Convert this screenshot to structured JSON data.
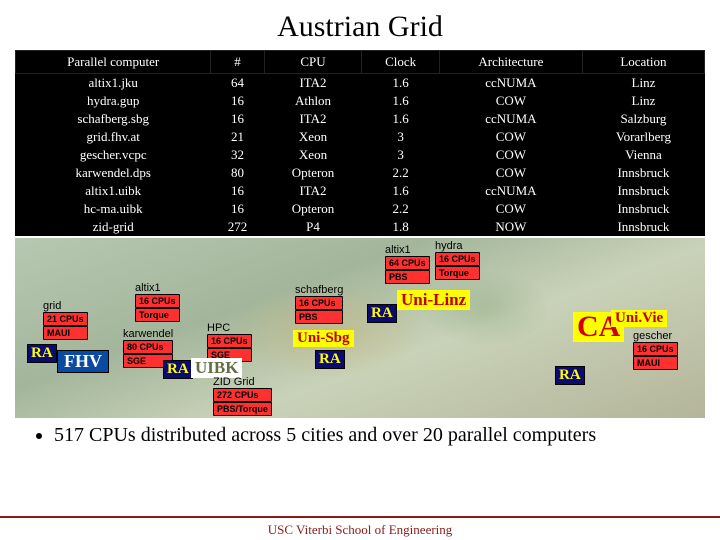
{
  "title": "Austrian Grid",
  "table": {
    "headers": [
      "Parallel computer",
      "#",
      "CPU",
      "Clock",
      "Architecture",
      "Location"
    ],
    "rows": [
      [
        "altix1.jku",
        "64",
        "ITA2",
        "1.6",
        "ccNUMA",
        "Linz"
      ],
      [
        "hydra.gup",
        "16",
        "Athlon",
        "1.6",
        "COW",
        "Linz"
      ],
      [
        "schafberg.sbg",
        "16",
        "ITA2",
        "1.6",
        "ccNUMA",
        "Salzburg"
      ],
      [
        "grid.fhv.at",
        "21",
        "Xeon",
        "3",
        "COW",
        "Vorarlberg"
      ],
      [
        "gescher.vcpc",
        "32",
        "Xeon",
        "3",
        "COW",
        "Vienna"
      ],
      [
        "karwendel.dps",
        "80",
        "Opteron",
        "2.2",
        "COW",
        "Innsbruck"
      ],
      [
        "altix1.uibk",
        "16",
        "ITA2",
        "1.6",
        "ccNUMA",
        "Innsbruck"
      ],
      [
        "hc-ma.uibk",
        "16",
        "Opteron",
        "2.2",
        "COW",
        "Innsbruck"
      ],
      [
        "zid-grid",
        "272",
        "P4",
        "1.8",
        "NOW",
        "Innsbruck"
      ]
    ]
  },
  "map": {
    "grid": {
      "name": "grid",
      "cpus": "21 CPUs",
      "sched": "MAUI"
    },
    "altix_ibk": {
      "name": "altix1",
      "cpus": "16 CPUs",
      "sched": "Torque"
    },
    "karwendel": {
      "name": "karwendel",
      "cpus": "80 CPUs",
      "sched": "SGE"
    },
    "hpc": {
      "name": "HPC",
      "cpus": "16 CPUs",
      "sched": "SGE"
    },
    "zid": {
      "name": "ZID Grid",
      "cpus": "272 CPUs",
      "sched": "PBS/Torque"
    },
    "schafberg": {
      "name": "schafberg",
      "cpus": "16 CPUs",
      "sched": "PBS"
    },
    "altix_jku": {
      "name": "altix1",
      "cpus": "64 CPUs",
      "sched": "PBS"
    },
    "hydra": {
      "name": "hydra",
      "cpus": "16 CPUs",
      "sched": "Torque"
    },
    "gescher": {
      "name": "gescher",
      "cpus": "16 CPUs",
      "sched": "MAUI"
    },
    "labels": {
      "fhv": "FHV",
      "uibk": "UIBK",
      "uni_sbg": "Uni-Sbg",
      "uni_linz": "Uni-Linz",
      "uni_vie": "Uni.Vie",
      "ra": "RA",
      "ca": "CA"
    }
  },
  "bullet": "517 CPUs distributed across 5 cities and over 20 parallel computers",
  "footer": "USC Viterbi School of Engineering",
  "chart_data": {
    "type": "table",
    "title": "Austrian Grid",
    "columns": [
      "Parallel computer",
      "#",
      "CPU",
      "Clock",
      "Architecture",
      "Location"
    ],
    "rows": [
      [
        "altix1.jku",
        64,
        "ITA2",
        1.6,
        "ccNUMA",
        "Linz"
      ],
      [
        "hydra.gup",
        16,
        "Athlon",
        1.6,
        "COW",
        "Linz"
      ],
      [
        "schafberg.sbg",
        16,
        "ITA2",
        1.6,
        "ccNUMA",
        "Salzburg"
      ],
      [
        "grid.fhv.at",
        21,
        "Xeon",
        3,
        "COW",
        "Vorarlberg"
      ],
      [
        "gescher.vcpc",
        32,
        "Xeon",
        3,
        "COW",
        "Vienna"
      ],
      [
        "karwendel.dps",
        80,
        "Opteron",
        2.2,
        "COW",
        "Innsbruck"
      ],
      [
        "altix1.uibk",
        16,
        "ITA2",
        1.6,
        "ccNUMA",
        "Innsbruck"
      ],
      [
        "hc-ma.uibk",
        16,
        "Opteron",
        2.2,
        "COW",
        "Innsbruck"
      ],
      [
        "zid-grid",
        272,
        "P4",
        1.8,
        "NOW",
        "Innsbruck"
      ]
    ],
    "totals": {
      "cpu_count": 517,
      "cities": 5,
      "computers": ">20"
    }
  }
}
